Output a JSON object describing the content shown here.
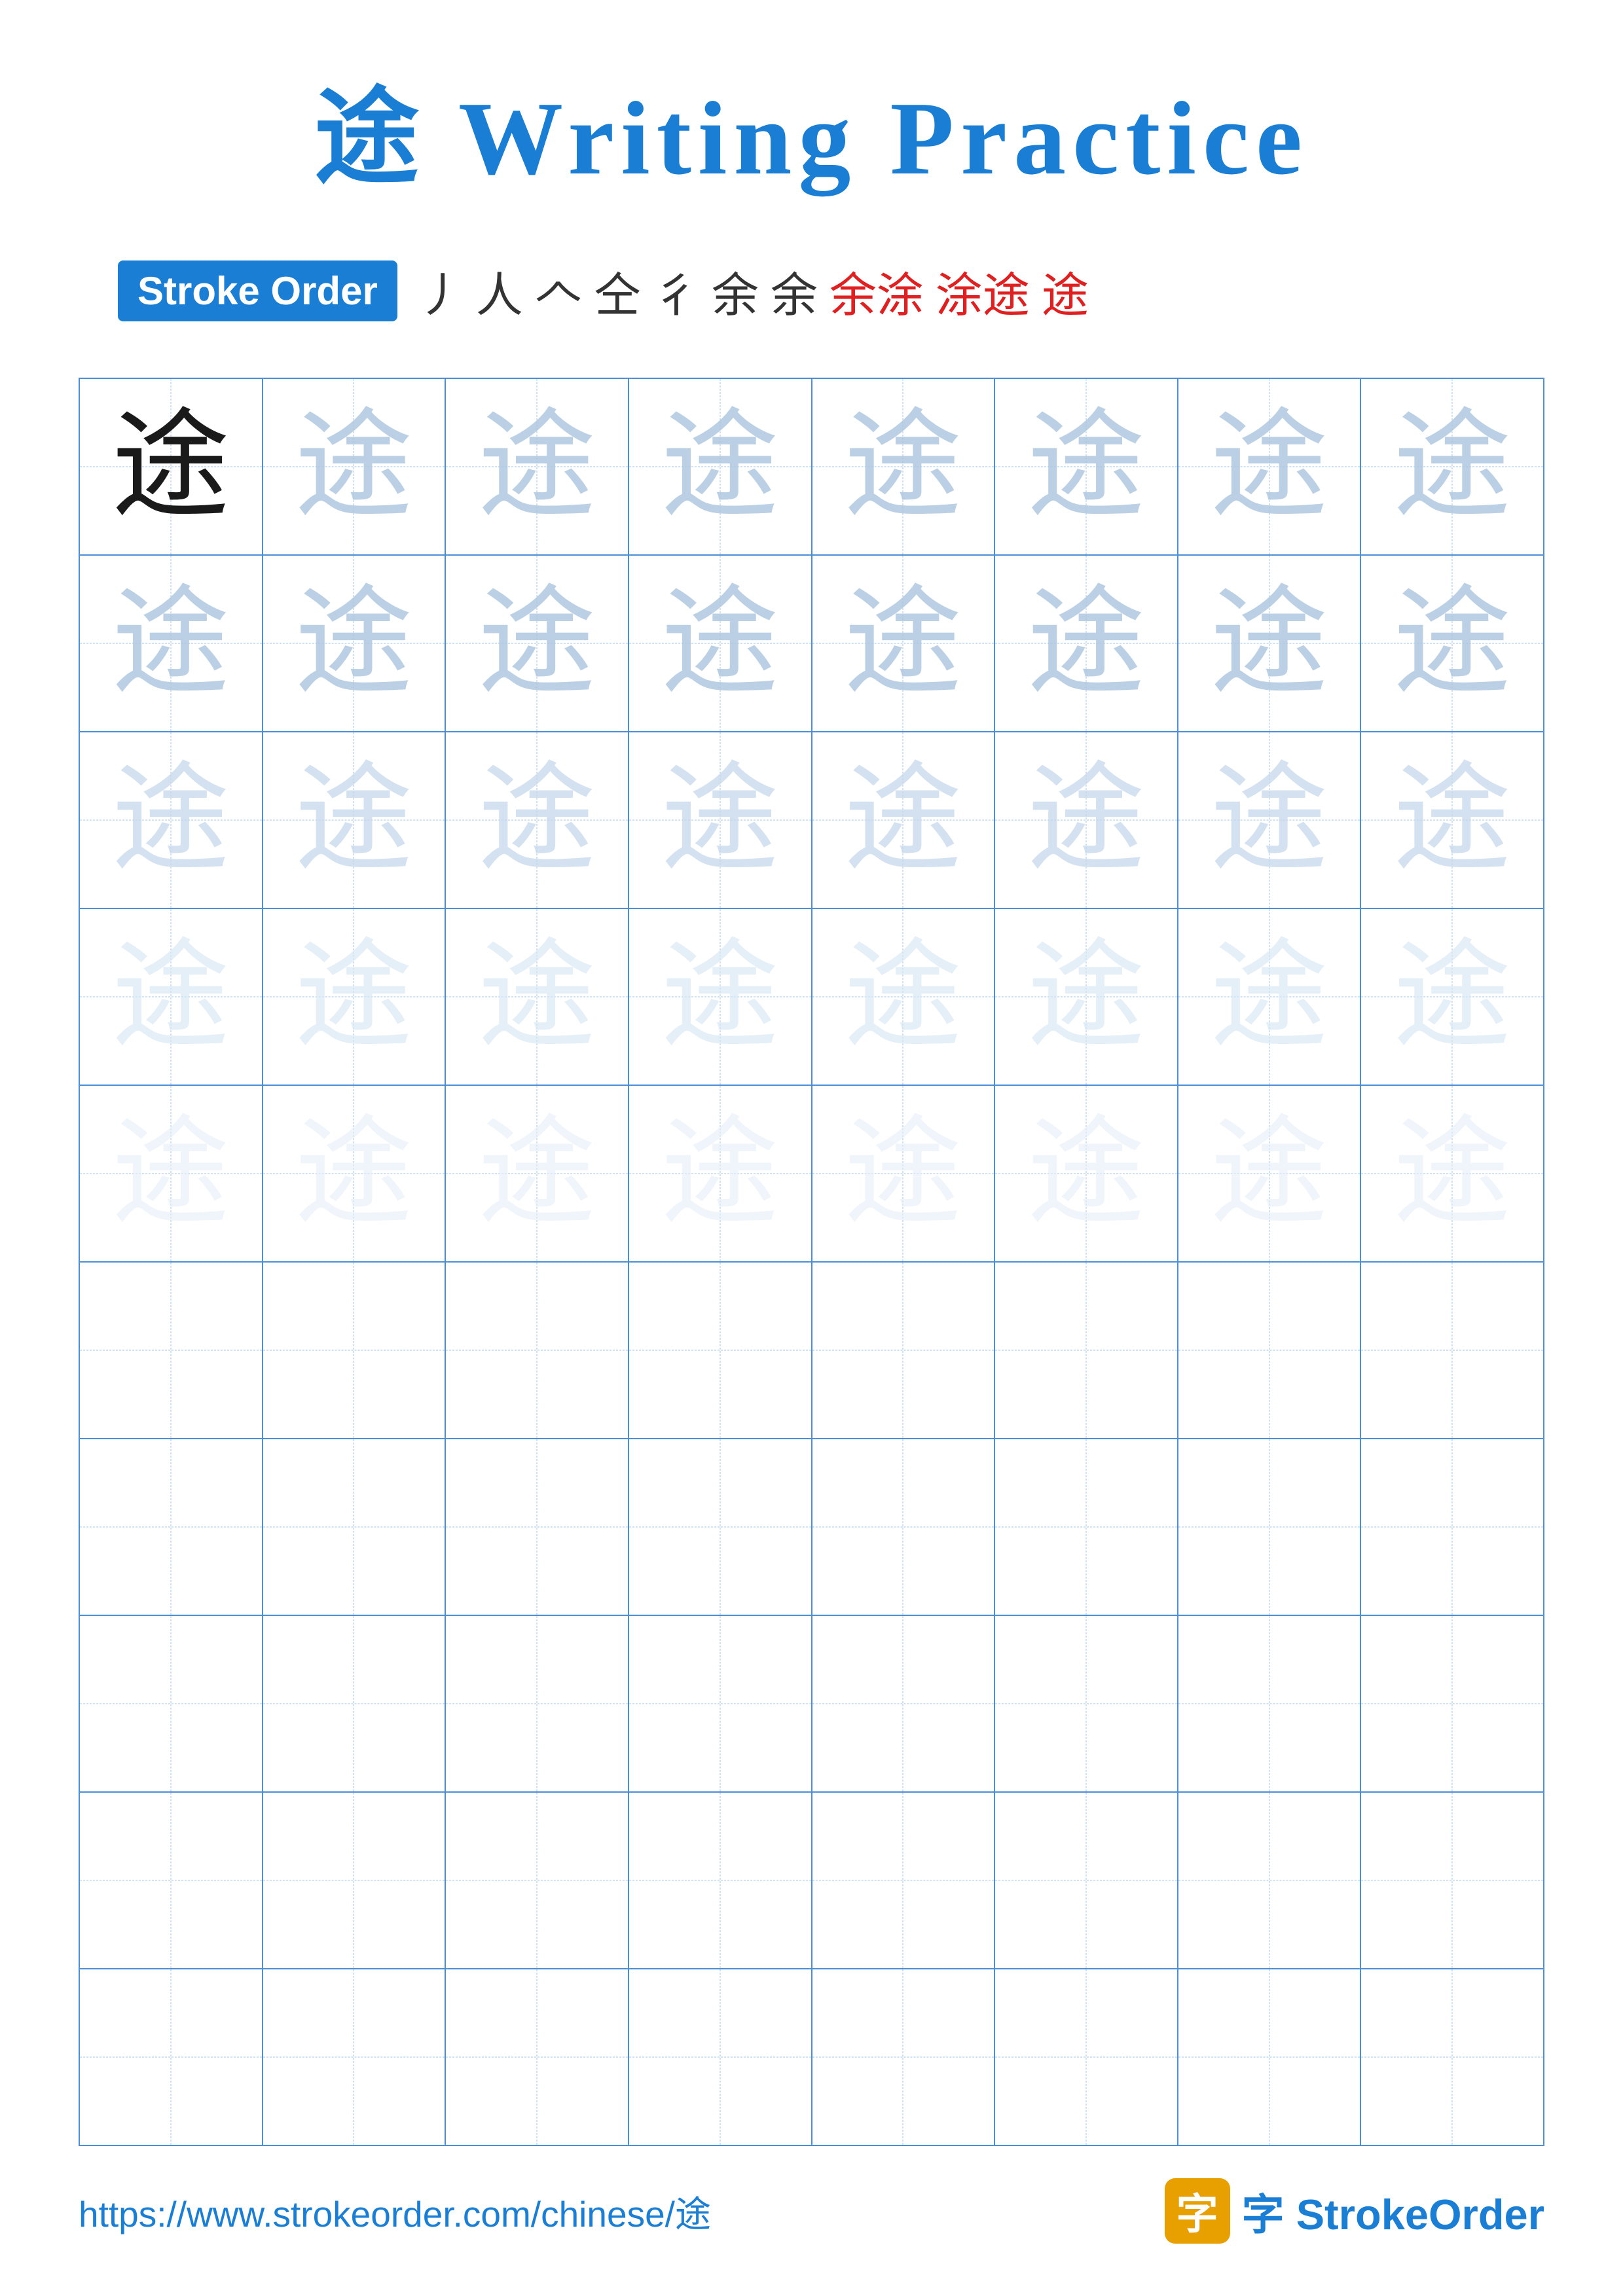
{
  "title": {
    "char": "途",
    "text": " Writing Practice"
  },
  "stroke_order": {
    "badge_label": "Stroke Order",
    "steps": [
      "丿",
      "人",
      "人",
      "仝",
      "彳",
      "余",
      "余",
      "余涂",
      "涂途",
      "途"
    ]
  },
  "grid": {
    "rows": 10,
    "cols": 8,
    "char": "途",
    "ghost_rows": 5,
    "empty_rows": 5
  },
  "footer": {
    "url": "https://www.strokeorder.com/chinese/途",
    "brand": "StrokeOrder",
    "brand_accent": "字"
  }
}
